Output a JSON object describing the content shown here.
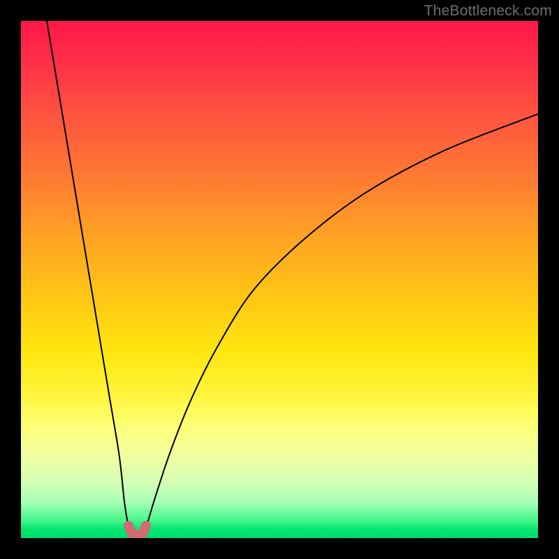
{
  "watermark": {
    "text": "TheBottleneck.com"
  },
  "chart_data": {
    "type": "line",
    "title": "",
    "xlabel": "",
    "ylabel": "",
    "xlim": [
      0,
      100
    ],
    "ylim": [
      0,
      100
    ],
    "grid": false,
    "legend": false,
    "background_gradient": {
      "direction": "vertical",
      "stops": [
        {
          "pct": 0,
          "color": "#ff1749"
        },
        {
          "pct": 18,
          "color": "#ff5340"
        },
        {
          "pct": 42,
          "color": "#ffa423"
        },
        {
          "pct": 64,
          "color": "#ffe60f"
        },
        {
          "pct": 84,
          "color": "#f2ffa0"
        },
        {
          "pct": 96,
          "color": "#47f78b"
        },
        {
          "pct": 100,
          "color": "#00de6d"
        }
      ]
    },
    "series": [
      {
        "name": "left-branch",
        "color": "#000000",
        "stroke_width": 2,
        "x": [
          5,
          7,
          9,
          11,
          13,
          15,
          17,
          19,
          20,
          20.8
        ],
        "values": [
          100,
          88,
          76,
          64,
          52,
          40,
          28,
          16,
          7,
          2
        ]
      },
      {
        "name": "right-branch",
        "color": "#000000",
        "stroke_width": 2,
        "x": [
          24.2,
          26,
          29,
          33,
          38,
          45,
          55,
          67,
          82,
          100
        ],
        "values": [
          2,
          8,
          17,
          27,
          37,
          48,
          58,
          67,
          75,
          82
        ]
      },
      {
        "name": "valley-marker",
        "color": "#d16a72",
        "stroke_width": 14,
        "linecap": "round",
        "x": [
          20.8,
          21.5,
          22.5,
          23.5,
          24.2
        ],
        "values": [
          2.4,
          0.8,
          0.4,
          0.8,
          2.4
        ]
      }
    ]
  }
}
